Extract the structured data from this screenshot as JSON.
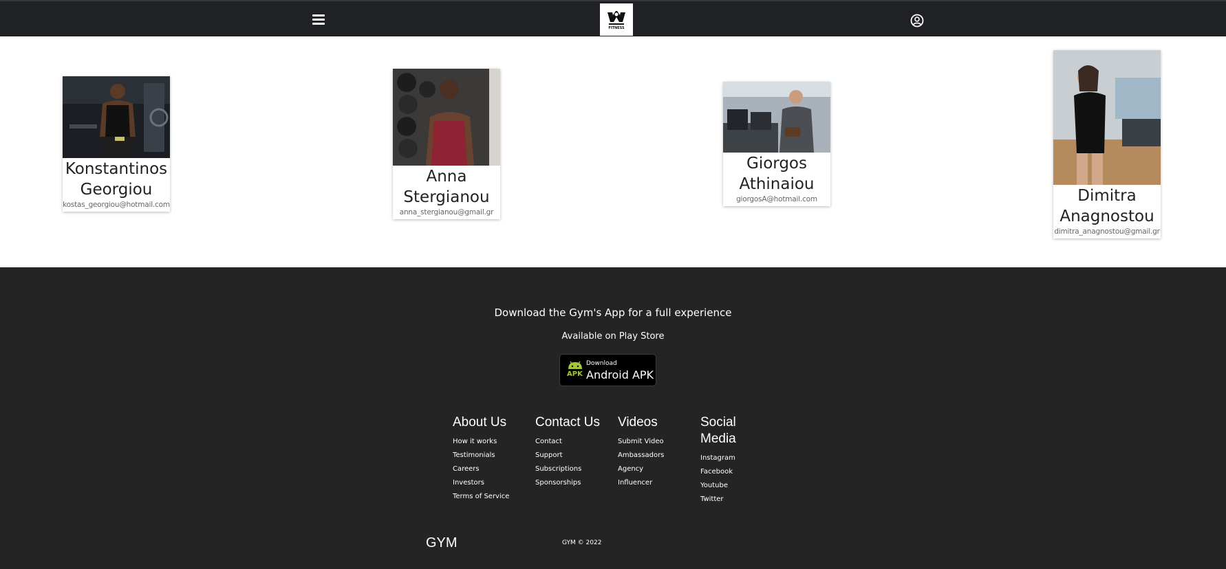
{
  "navbar": {
    "logo_text": "FITNESS",
    "icons": {
      "menu": "hamburger-menu-icon",
      "user": "user-circle-icon"
    },
    "background": "#202124"
  },
  "team": {
    "members": [
      {
        "name": "Konstantinos Georgiou",
        "email": "kostas_georgiou@hotmail.com"
      },
      {
        "name": "Anna Stergianou",
        "email": "anna_stergianou@gmail.gr"
      },
      {
        "name": "Giorgos Athinaiou",
        "email": "giorgosA@hotmail.com"
      },
      {
        "name": "Dimitra Anagnostou",
        "email": "dimitra_anagnostou@gmail.gr"
      }
    ]
  },
  "footer": {
    "download_text": "Download the Gym's App for a full experience",
    "available_text": "Available on Play Store",
    "apk_button": {
      "small": "Download",
      "big": "Android APK",
      "tag": "APK",
      "accent": "#a4c639"
    },
    "columns": [
      {
        "title": "About Us",
        "links": [
          "How it works",
          "Testimonials",
          "Careers",
          "Investors",
          "Terms of Service"
        ]
      },
      {
        "title": "Contact Us",
        "links": [
          "Contact",
          "Support",
          "Subscriptions",
          "Sponsorships"
        ]
      },
      {
        "title": "Videos",
        "links": [
          "Submit Video",
          "Ambassadors",
          "Agency",
          "Influencer"
        ]
      },
      {
        "title": "Social Media",
        "links": [
          "Instagram",
          "Facebook",
          "Youtube",
          "Twitter"
        ]
      }
    ],
    "brand": "GYM",
    "copyright": "GYM © 2022",
    "background": "#242424"
  }
}
